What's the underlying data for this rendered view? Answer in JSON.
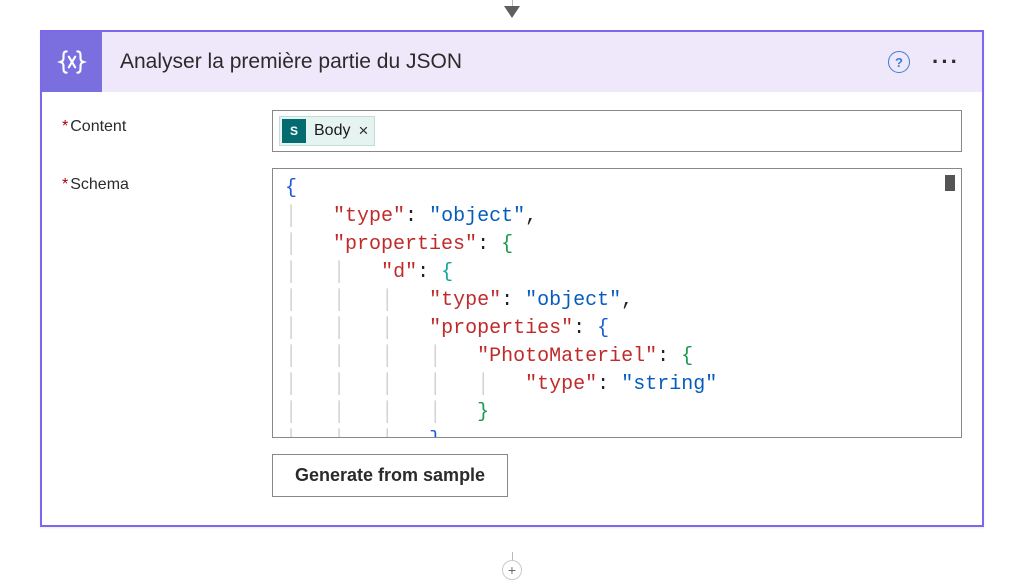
{
  "card": {
    "title": "Analyser la première partie du JSON",
    "icon": "parse-json"
  },
  "fields": {
    "content": {
      "label": "Content"
    },
    "schema": {
      "label": "Schema"
    }
  },
  "content_token": {
    "label": "Body",
    "icon_letter": "S"
  },
  "schema_code": {
    "lines": [
      {
        "indent": 0,
        "parts": [
          {
            "t": "{",
            "c": "brace-blue"
          }
        ]
      },
      {
        "indent": 1,
        "parts": [
          {
            "t": "\"type\"",
            "c": "key-red"
          },
          {
            "t": ": ",
            "c": "colon"
          },
          {
            "t": "\"object\"",
            "c": "key"
          },
          {
            "t": ",",
            "c": "comma"
          }
        ]
      },
      {
        "indent": 1,
        "parts": [
          {
            "t": "\"properties\"",
            "c": "key-red"
          },
          {
            "t": ": ",
            "c": "colon"
          },
          {
            "t": "{",
            "c": "brace-green"
          }
        ]
      },
      {
        "indent": 2,
        "parts": [
          {
            "t": "\"d\"",
            "c": "key-red"
          },
          {
            "t": ": ",
            "c": "colon"
          },
          {
            "t": "{",
            "c": "brace-teal"
          }
        ]
      },
      {
        "indent": 3,
        "parts": [
          {
            "t": "\"type\"",
            "c": "key-red"
          },
          {
            "t": ": ",
            "c": "colon"
          },
          {
            "t": "\"object\"",
            "c": "key"
          },
          {
            "t": ",",
            "c": "comma"
          }
        ]
      },
      {
        "indent": 3,
        "parts": [
          {
            "t": "\"properties\"",
            "c": "key-red"
          },
          {
            "t": ": ",
            "c": "colon"
          },
          {
            "t": "{",
            "c": "brace-blue"
          }
        ]
      },
      {
        "indent": 4,
        "parts": [
          {
            "t": "\"PhotoMateriel\"",
            "c": "key-red"
          },
          {
            "t": ": ",
            "c": "colon"
          },
          {
            "t": "{",
            "c": "brace-green"
          }
        ]
      },
      {
        "indent": 5,
        "parts": [
          {
            "t": "\"type\"",
            "c": "key-red"
          },
          {
            "t": ": ",
            "c": "colon"
          },
          {
            "t": "\"string\"",
            "c": "key"
          }
        ]
      },
      {
        "indent": 4,
        "parts": [
          {
            "t": "}",
            "c": "brace-green"
          }
        ]
      },
      {
        "indent": 3,
        "parts": [
          {
            "t": "}",
            "c": "brace-blue"
          }
        ]
      }
    ]
  },
  "buttons": {
    "generate": "Generate from sample"
  }
}
